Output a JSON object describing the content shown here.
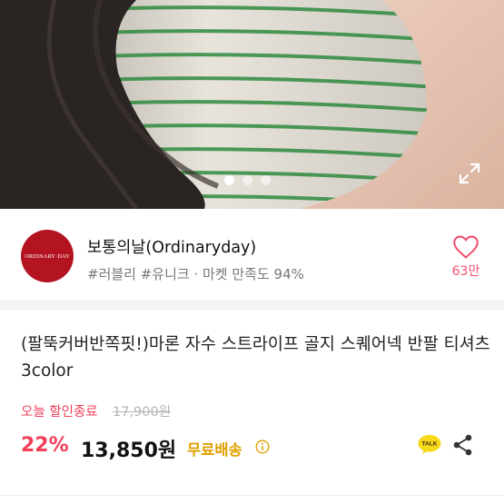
{
  "hero": {
    "carousel_count": 3,
    "carousel_active_index": 0
  },
  "seller": {
    "logo_text": "ORDINARY·DAY",
    "name": "보통의날(Ordinaryday)",
    "tags": "#러블리 #유니크 · 마켓 만족도 94%",
    "like_count": "63만"
  },
  "product": {
    "title": "(팔뚝커버반쪽핏!)마론 자수 스트라이프 골지 스퀘어넥 반팔 티셔츠 3color",
    "today_label": "오늘 할인종료",
    "original_price": "17,900원",
    "discount": "22%",
    "price": "13,850원",
    "shipping": "무료배송"
  },
  "icons": {
    "expand": "expand-icon",
    "heart": "heart-icon",
    "info": "info-icon",
    "talk": "kakao-talk-icon",
    "share": "share-icon"
  },
  "colors": {
    "accent_pink": "#f0405a",
    "brand_red": "#b3141f",
    "shipping_yellow": "#e0a100",
    "talk_yellow": "#f7d917",
    "stripe_green": "#2f8a3f"
  }
}
